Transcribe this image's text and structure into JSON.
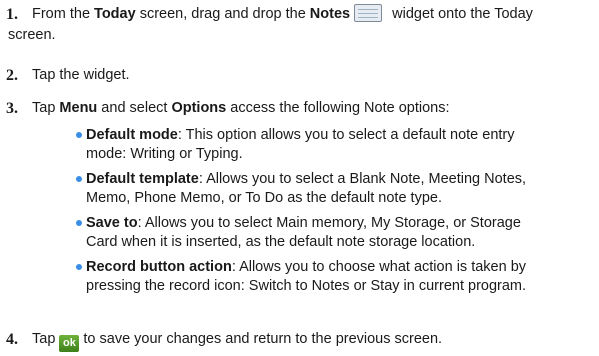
{
  "colors": {
    "bullet": "#3a8ee6",
    "ok_button": "#4d9626"
  },
  "steps": [
    {
      "num": "1.",
      "p1": "From the ",
      "b1": "Today",
      "p2": " screen, drag and drop the ",
      "b2": "Notes",
      "p3": " widget onto the Today",
      "line2": "screen.",
      "icon": "notes-widget-icon"
    },
    {
      "num": "2.",
      "text": "Tap the widget."
    },
    {
      "num": "3.",
      "p1": "Tap ",
      "b1": "Menu",
      "p2": " and select ",
      "b2": "Options",
      "p3": " access the following Note options:"
    },
    {
      "num": "4.",
      "p1": "Tap",
      "icon_label": "ok",
      "p2": "to save your changes and return to the previous screen."
    }
  ],
  "options": [
    {
      "term": "Default mode",
      "l1": ": This option allows you to select a default note entry",
      "l2": "mode: Writing or Typing."
    },
    {
      "term": "Default template",
      "l1": ": Allows you to select a Blank Note, Meeting Notes,",
      "l2": "Memo, Phone Memo, or To Do as the default note type."
    },
    {
      "term": "Save to",
      "l1": ": Allows you to select Main memory, My Storage, or Storage",
      "l2": "Card when it is inserted, as the default note storage location."
    },
    {
      "term": "Record button action",
      "l1": ": Allows you to choose what action is taken by",
      "l2": "pressing the record icon: Switch to Notes or Stay in current program."
    }
  ]
}
